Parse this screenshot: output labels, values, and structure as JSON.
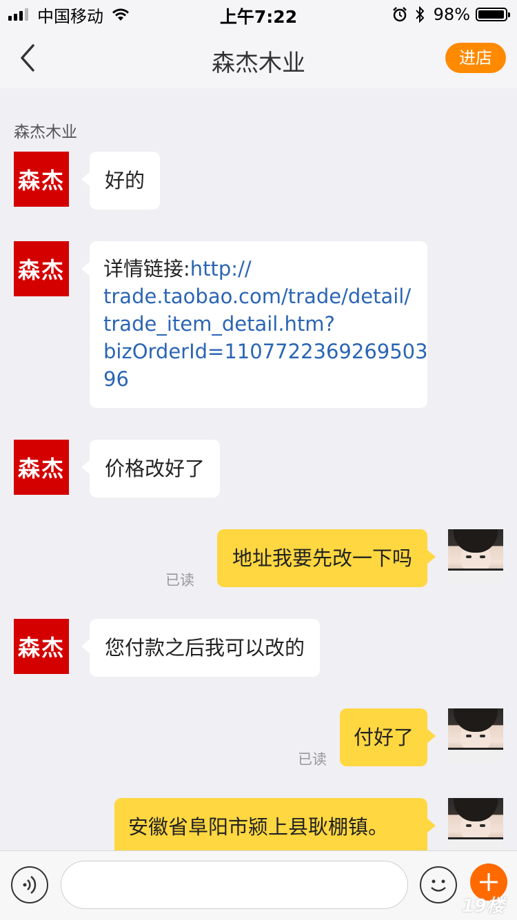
{
  "status_bar": {
    "carrier": "中国移动",
    "time": "上午7:22",
    "battery": "98%",
    "battery_level": 0.98
  },
  "nav": {
    "title": "森杰木业",
    "enter_shop": "进店"
  },
  "chat": {
    "sender_name": "森杰木业",
    "shop_avatar_text": "森杰",
    "read_label": "已读",
    "messages": [
      {
        "from": "shop",
        "text": "好的"
      },
      {
        "from": "shop",
        "prefix": "详情链接:",
        "link_lines": [
          "http://",
          "trade.taobao.com/trade/detail/",
          "trade_item_detail.htm?",
          "bizOrderId=1107722369269503",
          "96"
        ]
      },
      {
        "from": "shop",
        "text": "价格改好了"
      },
      {
        "from": "user",
        "text": "地址我要先改一下吗",
        "status": "已读"
      },
      {
        "from": "shop",
        "text": "您付款之后我可以改的"
      },
      {
        "from": "user",
        "text": "付好了",
        "status": "已读"
      },
      {
        "from": "user",
        "text": "安徽省阜阳市颍上县耿棚镇。"
      }
    ]
  },
  "input_bar": {
    "placeholder": "",
    "watermark": "19楼"
  }
}
